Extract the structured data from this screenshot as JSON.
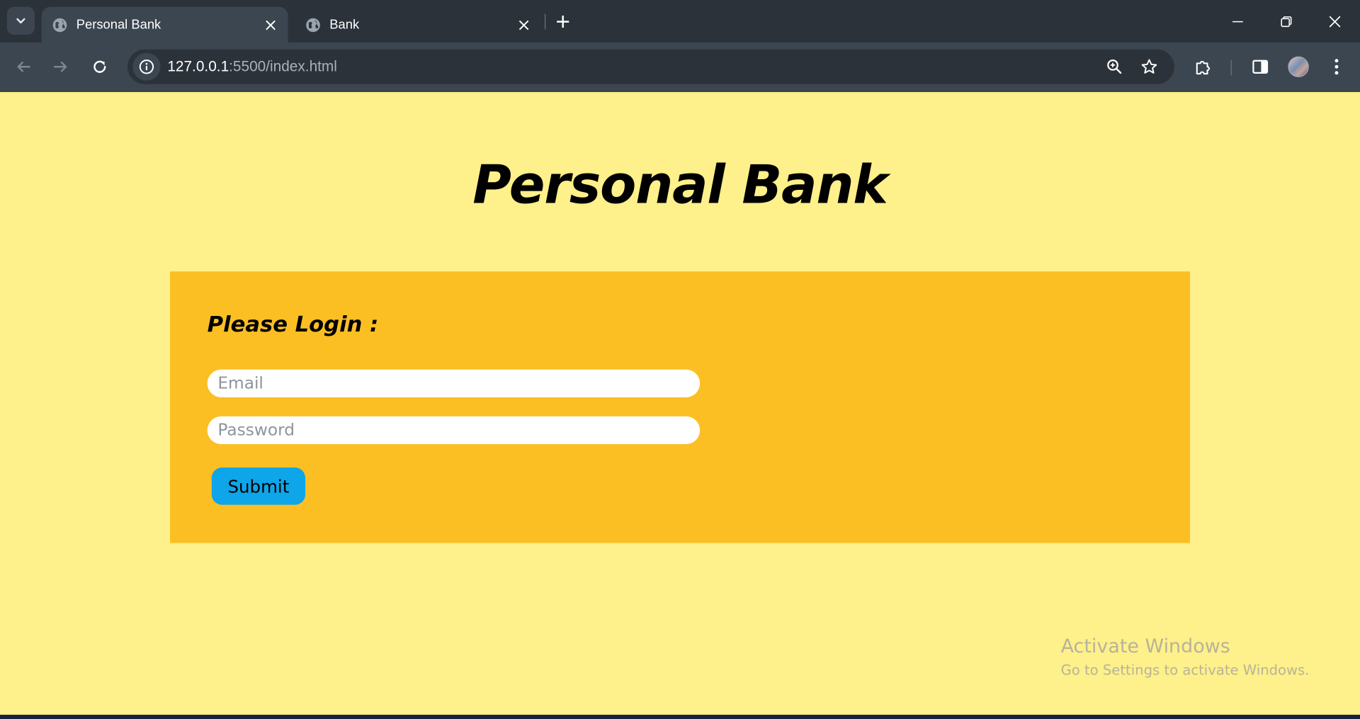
{
  "browser": {
    "tabs": [
      {
        "title": "Personal Bank",
        "active": true
      },
      {
        "title": "Bank",
        "active": false
      }
    ],
    "address": {
      "host": "127.0.0.1",
      "path": ":5500/index.html"
    },
    "icons": {
      "tab_search": "chevron-down-icon",
      "favicon": "globe-icon",
      "close": "close-icon",
      "new_tab": "plus-icon",
      "back": "arrow-left-icon",
      "forward": "arrow-right-icon",
      "reload": "reload-icon",
      "site_info": "info-icon",
      "zoom": "zoom-icon",
      "bookmark": "star-icon",
      "extensions": "puzzle-icon",
      "side_panel": "side-panel-icon",
      "menu": "kebab-menu-icon"
    }
  },
  "page": {
    "title": "Personal Bank",
    "login": {
      "heading": "Please Login :",
      "email_placeholder": "Email",
      "password_placeholder": "Password",
      "submit_label": "Submit"
    }
  },
  "watermark": {
    "line1": "Activate Windows",
    "line2": "Go to Settings to activate Windows."
  },
  "colors": {
    "page_background": "#fef08a",
    "card_background": "#fbbf24",
    "button_background": "#0ea5e9",
    "chrome_dark": "#2b323a",
    "chrome_toolbar": "#3c4650"
  }
}
